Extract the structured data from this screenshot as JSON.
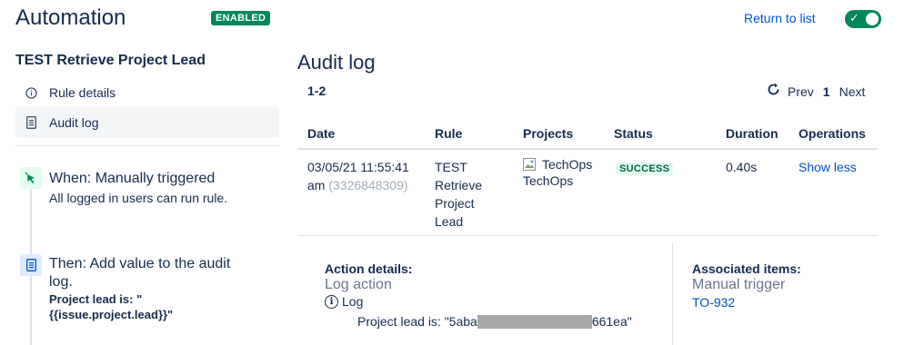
{
  "header": {
    "title": "Automation",
    "badge": "ENABLED",
    "return_link": "Return to list",
    "toggle_on": true
  },
  "sidebar": {
    "rule_name": "TEST Retrieve Project Lead",
    "items": [
      {
        "label": "Rule details",
        "icon": "info-icon"
      },
      {
        "label": "Audit log",
        "icon": "document-icon",
        "active": true
      }
    ],
    "components": [
      {
        "type": "trigger",
        "icon": "cursor-click-icon",
        "title": "When: Manually triggered",
        "description": "All logged in users can run rule."
      },
      {
        "type": "action",
        "icon": "document-icon",
        "title_line1": "Then: Add value to the audit",
        "title_line2": "log.",
        "detail_line1": "Project lead is: \"",
        "detail_line2": "{{issue.project.lead}}\""
      }
    ]
  },
  "audit": {
    "title": "Audit log",
    "range": "1-2",
    "pager": {
      "prev": "Prev",
      "page": "1",
      "next": "Next"
    },
    "columns": [
      "Date",
      "Rule",
      "Projects",
      "Status",
      "Duration",
      "Operations"
    ],
    "rows": [
      {
        "date_line1": "03/05/21 11:55:41",
        "date_line2": "am",
        "id": "(3326848309)",
        "rule": [
          "TEST",
          "Retrieve",
          "Project",
          "Lead"
        ],
        "project_alt": "TechOps",
        "project": "TechOps",
        "status": "SUCCESS",
        "duration": "0.40s",
        "operation": "Show less"
      }
    ],
    "details": {
      "action_label": "Action details:",
      "action_name": "Log action",
      "log_label": "Log",
      "log_value_prefix": "Project lead is: \"5aba",
      "log_value_suffix": "661ea\"",
      "associated_label": "Associated items:",
      "associated_name": "Manual trigger",
      "issue_link": "TO-932"
    }
  },
  "colors": {
    "accent": "#0052cc",
    "success": "#00875a",
    "text": "#172b4d"
  }
}
